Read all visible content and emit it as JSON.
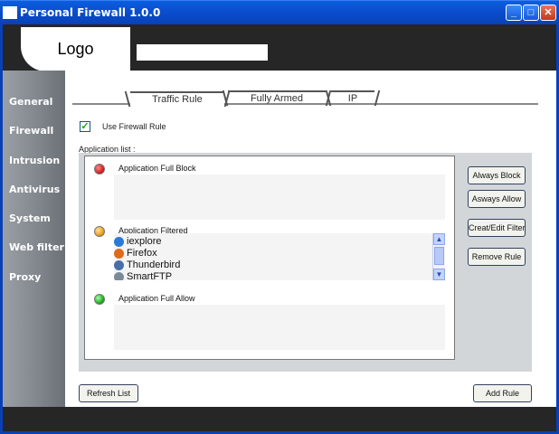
{
  "window": {
    "title": "Personal Firewall 1.0.0",
    "controls": {
      "minimize": "_",
      "maximize": "□",
      "close": "✕"
    }
  },
  "header": {
    "logo_text": "Logo"
  },
  "sidebar": {
    "items": [
      {
        "label": "General"
      },
      {
        "label": "Firewall"
      },
      {
        "label": "Intrusion"
      },
      {
        "label": "Antivirus"
      },
      {
        "label": "System"
      },
      {
        "label": "Web filter"
      },
      {
        "label": "Proxy"
      }
    ]
  },
  "tabs": [
    {
      "label": "Traffic Rule",
      "active": true
    },
    {
      "label": "Fully Armed",
      "active": false
    },
    {
      "label": "IP",
      "active": false
    }
  ],
  "firewall_rule": {
    "label": "Use Firewall Rule",
    "checked": true
  },
  "application_list": {
    "label": "Application list :",
    "groups": {
      "block": {
        "label": "Application Full Block",
        "color": "#d62020"
      },
      "filtered": {
        "label": "Application Filtered",
        "color": "#f0a020",
        "apps": [
          {
            "name": "iexplore",
            "icon": "ie-icon",
            "color": "#2a7ad8"
          },
          {
            "name": "Firefox",
            "icon": "firefox-icon",
            "color": "#e06a1a"
          },
          {
            "name": "Thunderbird",
            "icon": "thunderbird-icon",
            "color": "#4a6fa8"
          },
          {
            "name": "SmartFTP",
            "icon": "smartftp-icon",
            "color": "#7a8a9a"
          }
        ]
      },
      "allow": {
        "label": "Application Full Allow",
        "color": "#20b020"
      }
    }
  },
  "actions": {
    "always_block": "Always Block",
    "always_allow": "Asways Allow",
    "create_edit_filter": "Creat/Edit Filter",
    "remove_rule": "Remove Rule",
    "refresh_list": "Refresh List",
    "add_rule": "Add Rule"
  }
}
